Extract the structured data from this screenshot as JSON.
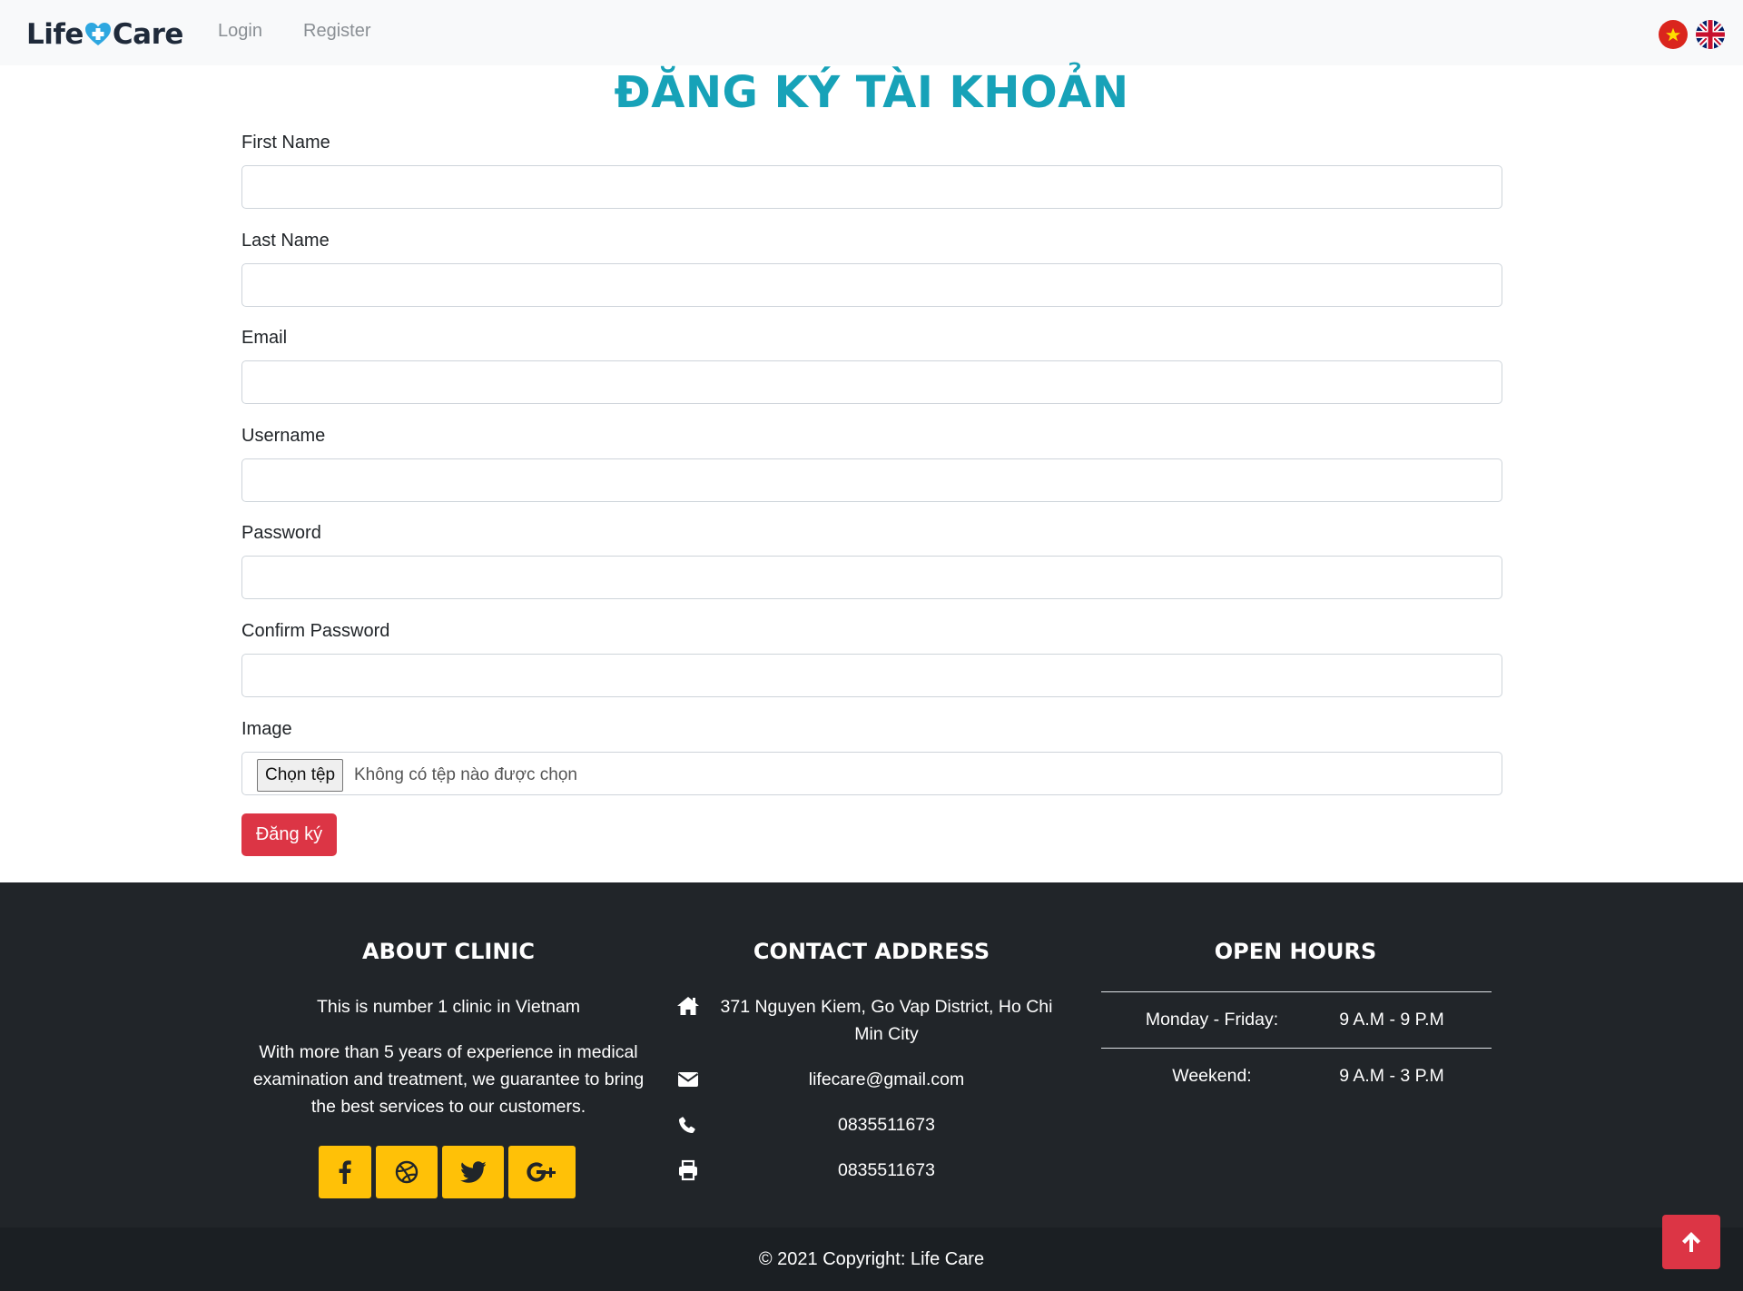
{
  "navbar": {
    "logo_left": "Life",
    "logo_right": "Care",
    "login": "Login",
    "register": "Register",
    "languages": [
      "vietnamese-flag",
      "uk-flag"
    ]
  },
  "form": {
    "title": "ĐĂNG KÝ TÀI KHOẢN",
    "first_name_label": "First Name",
    "last_name_label": "Last Name",
    "email_label": "Email",
    "username_label": "Username",
    "password_label": "Password",
    "confirm_password_label": "Confirm Password",
    "image_label": "Image",
    "file_button": "Chọn tệp",
    "file_status": "Không có tệp nào được chọn",
    "submit": "Đăng ký"
  },
  "footer": {
    "about": {
      "title": "ABOUT CLINIC",
      "line1": "This is number 1 clinic in Vietnam",
      "line2": "With more than 5 years of experience in medical examination and treatment, we guarantee to bring the best services to our customers.",
      "socials": [
        "facebook-icon",
        "dribbble-icon",
        "twitter-icon",
        "google-plus-icon"
      ]
    },
    "contact": {
      "title": "CONTACT ADDRESS",
      "address": "371 Nguyen Kiem, Go Vap District, Ho Chi Min City",
      "email": "lifecare@gmail.com",
      "phone": "0835511673",
      "fax": "0835511673"
    },
    "hours": {
      "title": "OPEN HOURS",
      "rows": [
        {
          "day": "Monday - Friday:",
          "time": "9 A.M - 9 P.M"
        },
        {
          "day": "Weekend:",
          "time": "9 A.M - 3 P.M"
        }
      ]
    },
    "copyright": "© 2021 Copyright: Life Care"
  },
  "colors": {
    "accent_title": "#17a2b8",
    "danger": "#dc3545",
    "social": "#ffc107",
    "footer_bg": "#212529"
  }
}
